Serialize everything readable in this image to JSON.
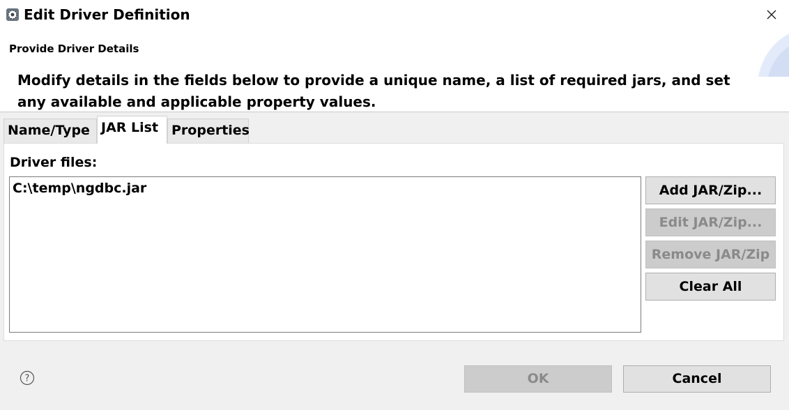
{
  "window": {
    "title": "Edit Driver Definition"
  },
  "banner": {
    "heading": "Provide Driver Details",
    "message": "Modify details in the fields below to provide a unique name, a list of required jars, and set any available and applicable property values."
  },
  "tabs": [
    {
      "label": "Name/Type",
      "active": false
    },
    {
      "label": "JAR List",
      "active": true
    },
    {
      "label": "Properties",
      "active": false
    }
  ],
  "jar_list": {
    "label": "Driver files:",
    "files": [
      "C:\\temp\\ngdbc.jar"
    ],
    "buttons": {
      "add": "Add JAR/Zip...",
      "edit": "Edit JAR/Zip...",
      "remove": "Remove JAR/Zip",
      "clear": "Clear All"
    }
  },
  "footer": {
    "ok": "OK",
    "cancel": "Cancel"
  },
  "icons": {
    "app": "driver-gear-icon",
    "close": "close-icon",
    "help": "help-icon"
  },
  "colors": {
    "dialog_bg": "#f0f0f0",
    "button_bg": "#e1e1e1",
    "disabled_text": "#8a8a8a",
    "banner_art": "#e3ebfa"
  }
}
